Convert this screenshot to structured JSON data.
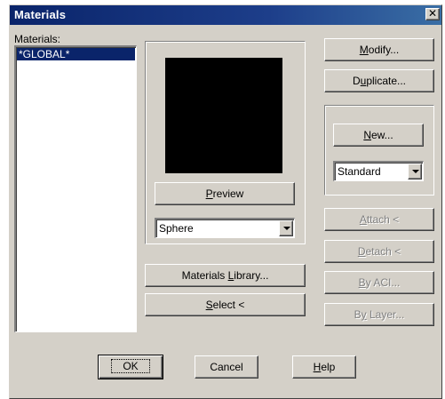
{
  "window": {
    "title": "Materials",
    "close_glyph": "✕"
  },
  "materials_list": {
    "label": "Materials:",
    "items": [
      "*GLOBAL*"
    ],
    "selected_index": 0
  },
  "preview": {
    "button_label_pre": "",
    "button_mnemonic": "P",
    "button_label_post": "review",
    "shape_value": "Sphere"
  },
  "buttons": {
    "modify": {
      "pre": "",
      "key": "M",
      "post": "odify..."
    },
    "duplicate": {
      "pre": "D",
      "key": "u",
      "post": "plicate..."
    },
    "new": {
      "pre": "",
      "key": "N",
      "post": "ew..."
    },
    "attach": {
      "pre": "",
      "key": "A",
      "post": "ttach <"
    },
    "detach": {
      "pre": "",
      "key": "D",
      "post": "etach <"
    },
    "by_aci": {
      "pre": "",
      "key": "B",
      "post": "y ACI..."
    },
    "by_layer": {
      "pre": "B",
      "key": "y",
      "post": " Layer..."
    },
    "materials_library": {
      "pre": "Materials ",
      "key": "L",
      "post": "ibrary..."
    },
    "select": {
      "pre": "",
      "key": "S",
      "post": "elect <"
    },
    "ok": "OK",
    "cancel": "Cancel",
    "help": {
      "pre": "",
      "key": "H",
      "post": "elp"
    }
  },
  "new_type": {
    "value": "Standard"
  },
  "colors": {
    "titlebar": "#0a246a",
    "face": "#d4d0c8",
    "selection": "#0a246a",
    "swatch": "#000000"
  }
}
